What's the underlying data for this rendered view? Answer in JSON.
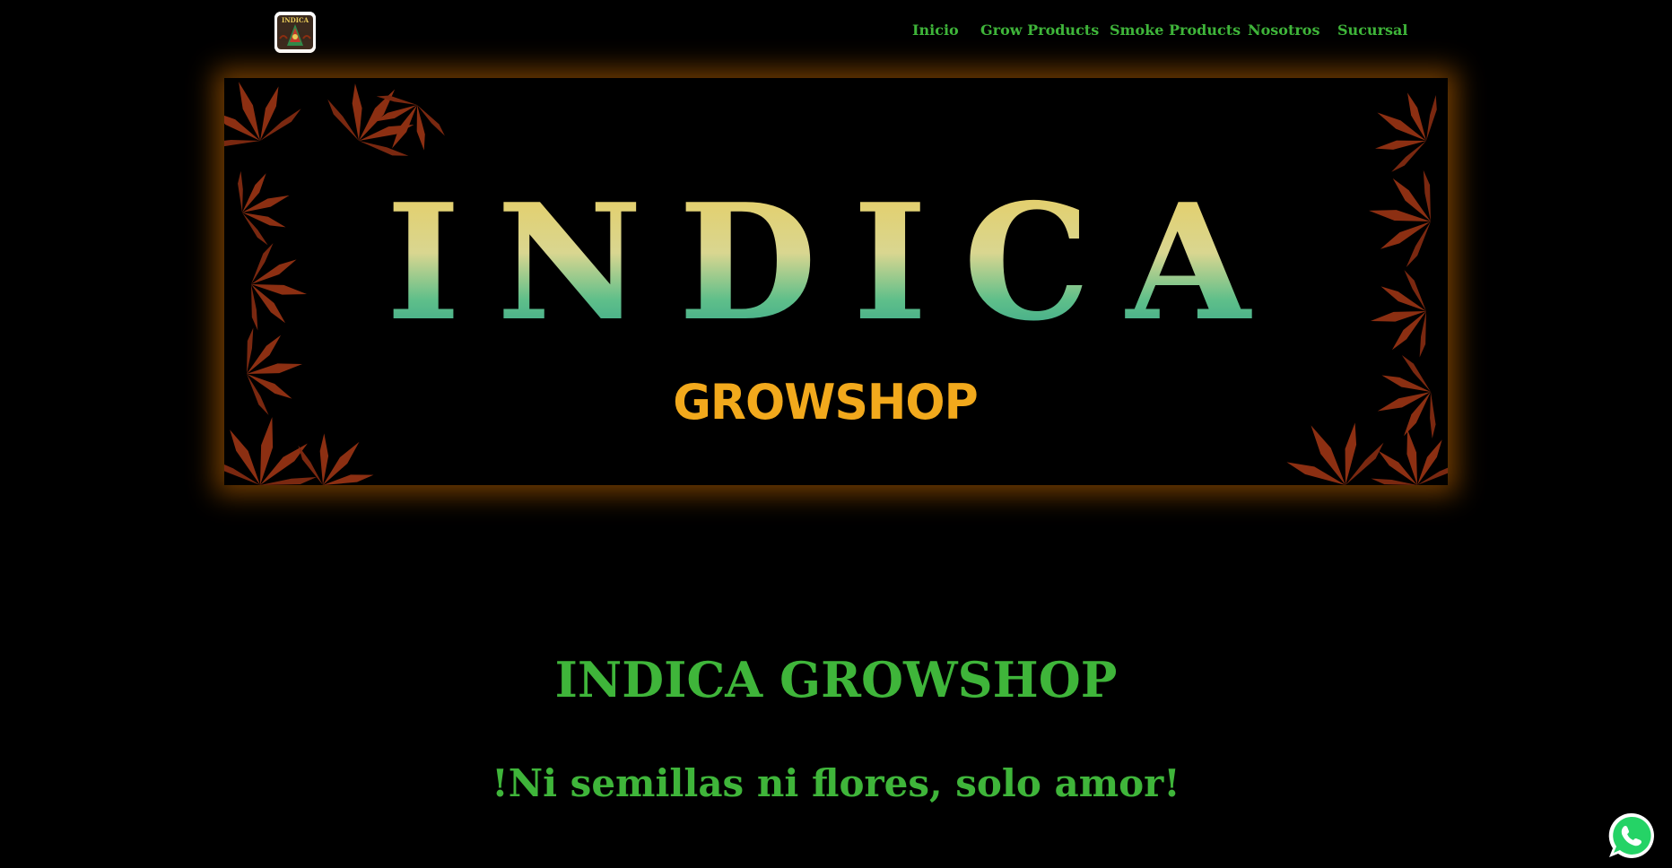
{
  "header": {
    "logo_text": "INDICA",
    "nav": [
      {
        "label": "Inicio"
      },
      {
        "label": "Grow Products"
      },
      {
        "label": "Smoke Products"
      },
      {
        "label": "Nosotros"
      },
      {
        "label": "Sucursal"
      }
    ]
  },
  "banner": {
    "title": "INDICA",
    "subtitle": "GROWSHOP"
  },
  "main": {
    "heading": "INDICA GROWSHOP",
    "tagline": "!Ni semillas ni flores, solo amor!"
  },
  "colors": {
    "background": "#000000",
    "nav_text": "#3fb53a",
    "heading_green": "#3fb53a",
    "banner_glow": "#cd6e00",
    "title_gradient_top": "#e9cc5a",
    "title_gradient_bottom": "#2a9c8a",
    "subtitle_orange": "#f2a91c",
    "leaf_color": "#8c2f12",
    "whatsapp_green": "#25d366"
  },
  "icons": {
    "whatsapp": "whatsapp-icon",
    "logo": "indica-logo-icon"
  }
}
